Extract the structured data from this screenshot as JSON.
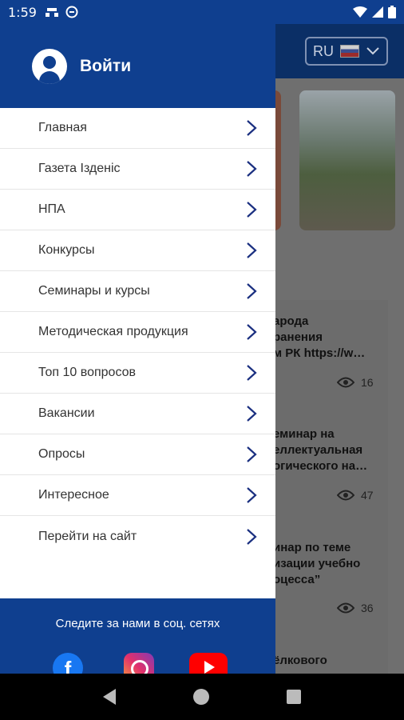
{
  "status": {
    "time": "1:59"
  },
  "background": {
    "language": "RU",
    "items": [
      {
        "text": "арода\nранения\nм РК https://w…",
        "views": "16"
      },
      {
        "text": "еминар на\nеллектуальная\nогического на…",
        "views": "47"
      },
      {
        "text": "инар по теме\nизации учебно\nоцесса”",
        "views": "36"
      },
      {
        "text": "ёлкового",
        "views": ""
      }
    ]
  },
  "drawer": {
    "login_label": "Войти",
    "menu": [
      {
        "label": "Главная"
      },
      {
        "label": "Газета Iзденiс"
      },
      {
        "label": "НПА"
      },
      {
        "label": "Конкурсы"
      },
      {
        "label": "Семинары и курсы"
      },
      {
        "label": "Методическая продукция"
      },
      {
        "label": "Топ 10 вопросов"
      },
      {
        "label": "Вакансии"
      },
      {
        "label": "Опросы"
      },
      {
        "label": "Интересное"
      },
      {
        "label": "Перейти на сайт"
      }
    ],
    "follow_text": "Следите за нами в соц. сетях",
    "social_icons": [
      "facebook-icon",
      "instagram-icon",
      "youtube-icon"
    ]
  },
  "colors": {
    "primary": "#0f3f8f",
    "chevron": "#1a2f80"
  }
}
